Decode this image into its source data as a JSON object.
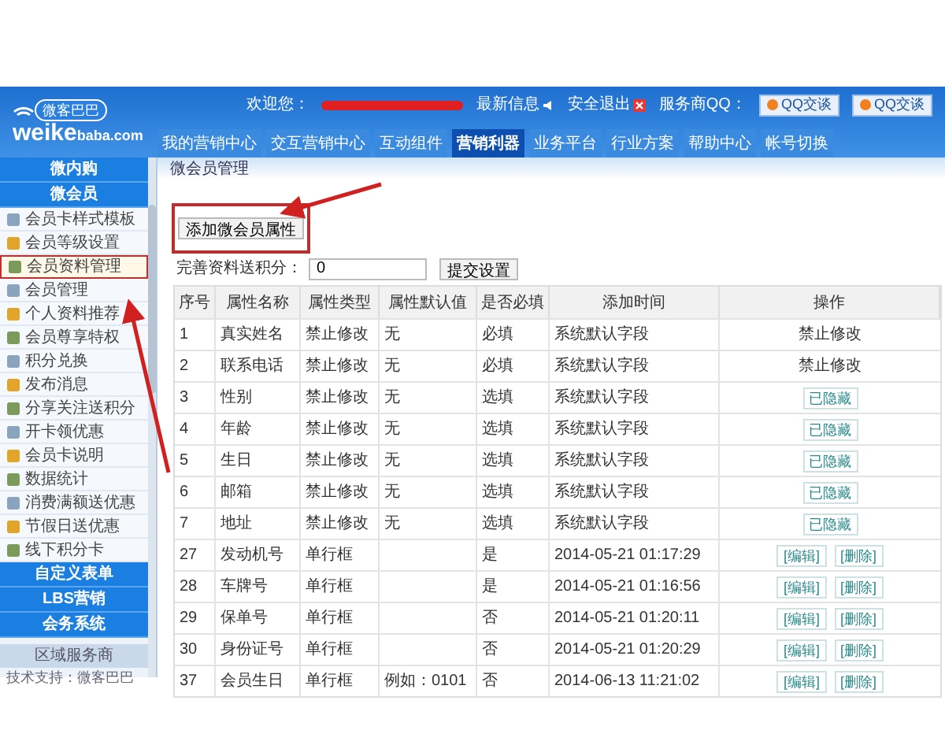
{
  "header": {
    "logo": {
      "name": "weike",
      "suffix": "baba.com",
      "badge": "微客巴巴"
    },
    "welcome": "欢迎您：",
    "links": [
      {
        "label": "最新信息",
        "kind": "news"
      },
      {
        "label": "安全退出",
        "kind": "logout"
      }
    ],
    "qq_label": "服务商QQ：",
    "qq_buttons": [
      "QQ交谈",
      "QQ交谈"
    ],
    "nav": [
      {
        "label": "我的营销中心",
        "selected": false
      },
      {
        "label": "交互营销中心",
        "selected": false
      },
      {
        "label": "互动组件",
        "selected": false
      },
      {
        "label": "营销利器",
        "selected": true
      },
      {
        "label": "业务平台",
        "selected": false
      },
      {
        "label": "行业方案",
        "selected": false
      },
      {
        "label": "帮助中心",
        "selected": false
      },
      {
        "label": "帐号切换",
        "selected": false
      }
    ]
  },
  "sidebar": {
    "sections_top": [
      "微内购",
      "微会员"
    ],
    "items": [
      {
        "label": "会员卡样式模板",
        "selected": false
      },
      {
        "label": "会员等级设置",
        "selected": false
      },
      {
        "label": "会员资料管理",
        "selected": true
      },
      {
        "label": "会员管理",
        "selected": false
      },
      {
        "label": "个人资料推荐",
        "selected": false
      },
      {
        "label": "会员尊享特权",
        "selected": false
      },
      {
        "label": "积分兑换",
        "selected": false
      },
      {
        "label": "发布消息",
        "selected": false
      },
      {
        "label": "分享关注送积分",
        "selected": false
      },
      {
        "label": "开卡领优惠",
        "selected": false
      },
      {
        "label": "会员卡说明",
        "selected": false
      },
      {
        "label": "数据统计",
        "selected": false
      },
      {
        "label": "消费满额送优惠",
        "selected": false
      },
      {
        "label": "节假日送优惠",
        "selected": false
      },
      {
        "label": "线下积分卡",
        "selected": false
      }
    ],
    "sections_bottom": [
      "自定义表单",
      "LBS营销",
      "会务系统"
    ],
    "footer_band": "区域服务商",
    "footer_text": "技术支持：微客巴巴"
  },
  "content": {
    "breadcrumb": "微会员管理",
    "add_button": "添加微会员属性",
    "points_label": "完善资料送积分：",
    "points_value": "0",
    "submit_button": "提交设置",
    "table": {
      "columns": [
        "序号",
        "属性名称",
        "属性类型",
        "属性默认值",
        "是否必填",
        "添加时间",
        "操作"
      ],
      "rows": [
        {
          "cells": [
            "1",
            "真实姓名",
            "禁止修改",
            "无",
            "必填",
            "系统默认字段"
          ],
          "actions": [
            {
              "label": "禁止修改",
              "kind": "text"
            }
          ]
        },
        {
          "cells": [
            "2",
            "联系电话",
            "禁止修改",
            "无",
            "必填",
            "系统默认字段"
          ],
          "actions": [
            {
              "label": "禁止修改",
              "kind": "text"
            }
          ]
        },
        {
          "cells": [
            "3",
            "性别",
            "禁止修改",
            "无",
            "选填",
            "系统默认字段"
          ],
          "actions": [
            {
              "label": "已隐藏",
              "kind": "button"
            }
          ]
        },
        {
          "cells": [
            "4",
            "年龄",
            "禁止修改",
            "无",
            "选填",
            "系统默认字段"
          ],
          "actions": [
            {
              "label": "已隐藏",
              "kind": "button"
            }
          ]
        },
        {
          "cells": [
            "5",
            "生日",
            "禁止修改",
            "无",
            "选填",
            "系统默认字段"
          ],
          "actions": [
            {
              "label": "已隐藏",
              "kind": "button"
            }
          ]
        },
        {
          "cells": [
            "6",
            "邮箱",
            "禁止修改",
            "无",
            "选填",
            "系统默认字段"
          ],
          "actions": [
            {
              "label": "已隐藏",
              "kind": "button"
            }
          ]
        },
        {
          "cells": [
            "7",
            "地址",
            "禁止修改",
            "无",
            "选填",
            "系统默认字段"
          ],
          "actions": [
            {
              "label": "已隐藏",
              "kind": "button"
            }
          ]
        },
        {
          "cells": [
            "27",
            "发动机号",
            "单行框",
            "",
            "是",
            "2014-05-21 01:17:29"
          ],
          "actions": [
            {
              "label": "[编辑]",
              "kind": "button"
            },
            {
              "label": "[删除]",
              "kind": "button"
            }
          ]
        },
        {
          "cells": [
            "28",
            "车牌号",
            "单行框",
            "",
            "是",
            "2014-05-21 01:16:56"
          ],
          "actions": [
            {
              "label": "[编辑]",
              "kind": "button"
            },
            {
              "label": "[删除]",
              "kind": "button"
            }
          ]
        },
        {
          "cells": [
            "29",
            "保单号",
            "单行框",
            "",
            "否",
            "2014-05-21 01:20:11"
          ],
          "actions": [
            {
              "label": "[编辑]",
              "kind": "button"
            },
            {
              "label": "[删除]",
              "kind": "button"
            }
          ]
        },
        {
          "cells": [
            "30",
            "身份证号",
            "单行框",
            "",
            "否",
            "2014-05-21 01:20:29"
          ],
          "actions": [
            {
              "label": "[编辑]",
              "kind": "button"
            },
            {
              "label": "[删除]",
              "kind": "button"
            }
          ]
        },
        {
          "cells": [
            "37",
            "会员生日",
            "单行框",
            "例如：0101",
            "否",
            "2014-06-13 11:21:02"
          ],
          "actions": [
            {
              "label": "[编辑]",
              "kind": "button"
            },
            {
              "label": "[删除]",
              "kind": "button"
            }
          ]
        }
      ]
    }
  }
}
